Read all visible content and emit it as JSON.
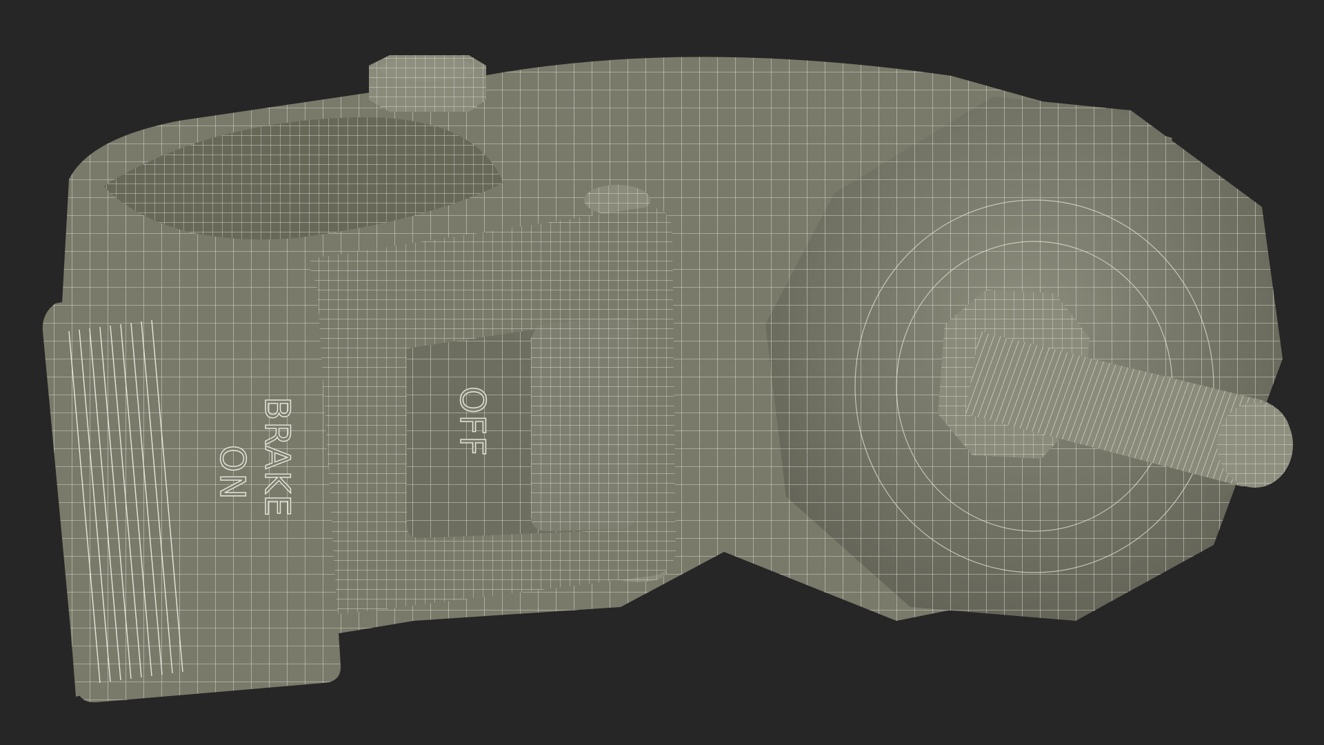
{
  "colors": {
    "background": "#262626",
    "body": "#7a7a6b",
    "body_light": "#8b8b7c",
    "body_dark": "#5e5e52",
    "wire": "#e8e8dc"
  },
  "labels": {
    "brake": "BRAKE",
    "on": "ON",
    "off": "OFF"
  }
}
